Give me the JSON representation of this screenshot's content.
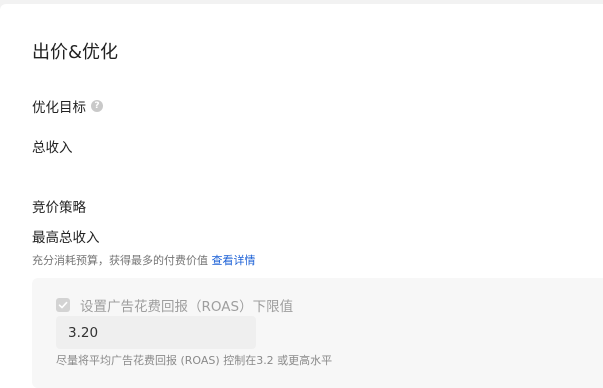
{
  "section": {
    "title": "出价&优化"
  },
  "optimization": {
    "label": "优化目标",
    "help_icon": "question-circle-icon",
    "value": "总收入"
  },
  "bidding": {
    "label": "竞价策略",
    "value": "最高总收入",
    "description": "充分消耗预算，获得最多的付费价值",
    "details_link": "查看详情"
  },
  "roas": {
    "checkbox_label": "设置广告花费回报（ROAS）下限值",
    "checked": true,
    "disabled": true,
    "input_value": "3.20",
    "hint": "尽量将平均广告花费回报 (ROAS) 控制在3.2 或更高水平"
  },
  "colors": {
    "link": "#1a5fd6",
    "muted_text": "#9e9e9e",
    "box_background": "#f7f7f7"
  }
}
